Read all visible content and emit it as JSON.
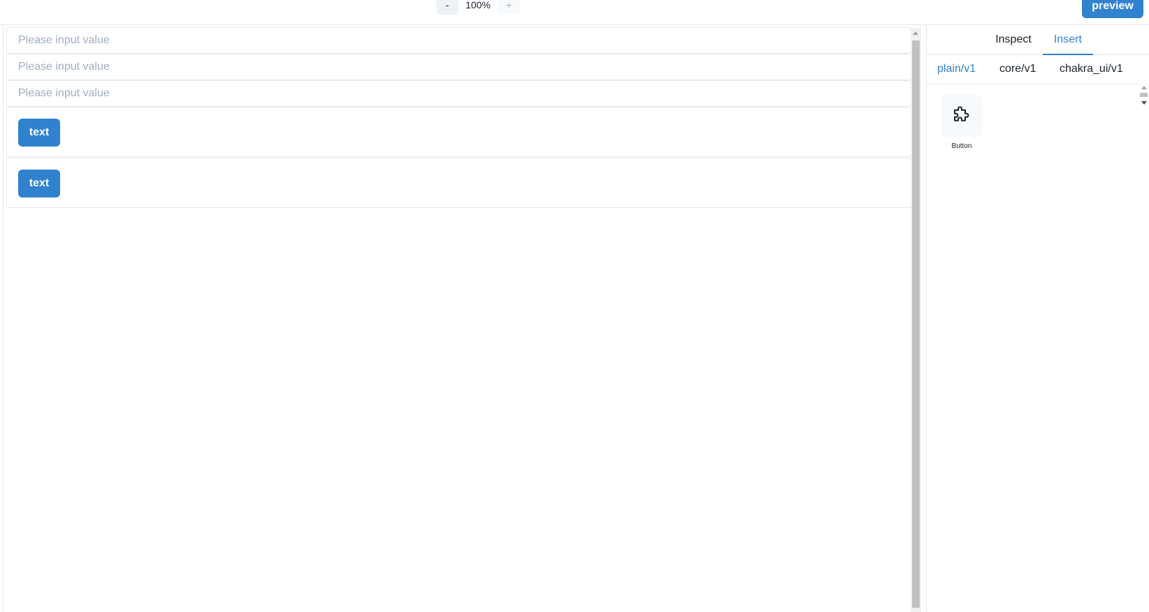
{
  "toolbar": {
    "zoom_out_label": "-",
    "zoom_level": "100%",
    "zoom_in_label": "+",
    "preview_label": "preview"
  },
  "canvas": {
    "inputs": [
      {
        "placeholder": "Please input value",
        "value": ""
      },
      {
        "placeholder": "Please input value",
        "value": ""
      },
      {
        "placeholder": "Please input value",
        "value": ""
      }
    ],
    "buttons": [
      {
        "label": "text"
      },
      {
        "label": "text"
      }
    ]
  },
  "right_panel": {
    "tabs": [
      {
        "label": "Inspect",
        "active": false
      },
      {
        "label": "Insert",
        "active": true
      }
    ],
    "libraries": [
      {
        "label": "plain/v1",
        "active": true
      },
      {
        "label": "core/v1",
        "active": false
      },
      {
        "label": "chakra_ui/v1",
        "active": false
      }
    ],
    "components": [
      {
        "label": "Button",
        "icon": "puzzle-piece-icon"
      }
    ]
  },
  "colors": {
    "accent": "#3182ce",
    "border": "#e2e8f0",
    "placeholder": "#a0aec0"
  }
}
